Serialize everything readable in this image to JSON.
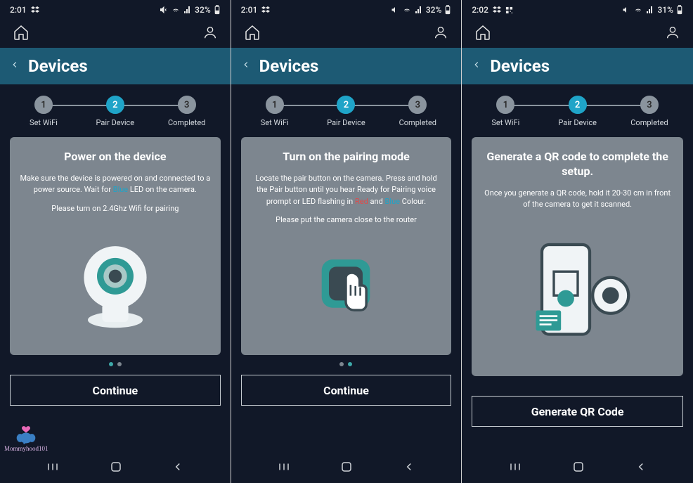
{
  "screens": [
    {
      "status": {
        "time": "2:01",
        "battery": "32%"
      },
      "title": "Devices",
      "steps": [
        {
          "num": "1",
          "label": "Set WiFi"
        },
        {
          "num": "2",
          "label": "Pair Device"
        },
        {
          "num": "3",
          "label": "Completed"
        }
      ],
      "card": {
        "title": "Power on the device",
        "body_pre": "Make sure the device is powered on and connected to a power source. Wait for ",
        "body_hl": "Blue",
        "body_post": " LED on the camera.",
        "body2": "Please turn on 2.4Ghz Wifi for pairing"
      },
      "dots_active": 0,
      "button": "Continue"
    },
    {
      "status": {
        "time": "2:01",
        "battery": "32%"
      },
      "title": "Devices",
      "steps": [
        {
          "num": "1",
          "label": "Set WiFi"
        },
        {
          "num": "2",
          "label": "Pair Device"
        },
        {
          "num": "3",
          "label": "Completed"
        }
      ],
      "card": {
        "title": "Turn on the pairing mode",
        "body_pre": "Locate the pair button on the camera. Press and hold the Pair button until you hear Ready for Pairing voice prompt or LED flashing in ",
        "body_hl_red": "Red",
        "body_mid": " and ",
        "body_hl_blue": "Blue",
        "body_post": " Colour.",
        "body2": "Please put the camera close to the router"
      },
      "dots_active": 1,
      "button": "Continue"
    },
    {
      "status": {
        "time": "2:02",
        "battery": "31%"
      },
      "title": "Devices",
      "steps": [
        {
          "num": "1",
          "label": "Set WiFi"
        },
        {
          "num": "2",
          "label": "Pair Device"
        },
        {
          "num": "3",
          "label": "Completed"
        }
      ],
      "card": {
        "title": "Generate a QR code to complete the setup.",
        "body": "Once you generate a QR code, hold it 20-30 cm in front of the camera to get it scanned."
      },
      "button": "Generate QR Code"
    }
  ],
  "watermark": "Mommyhood101"
}
